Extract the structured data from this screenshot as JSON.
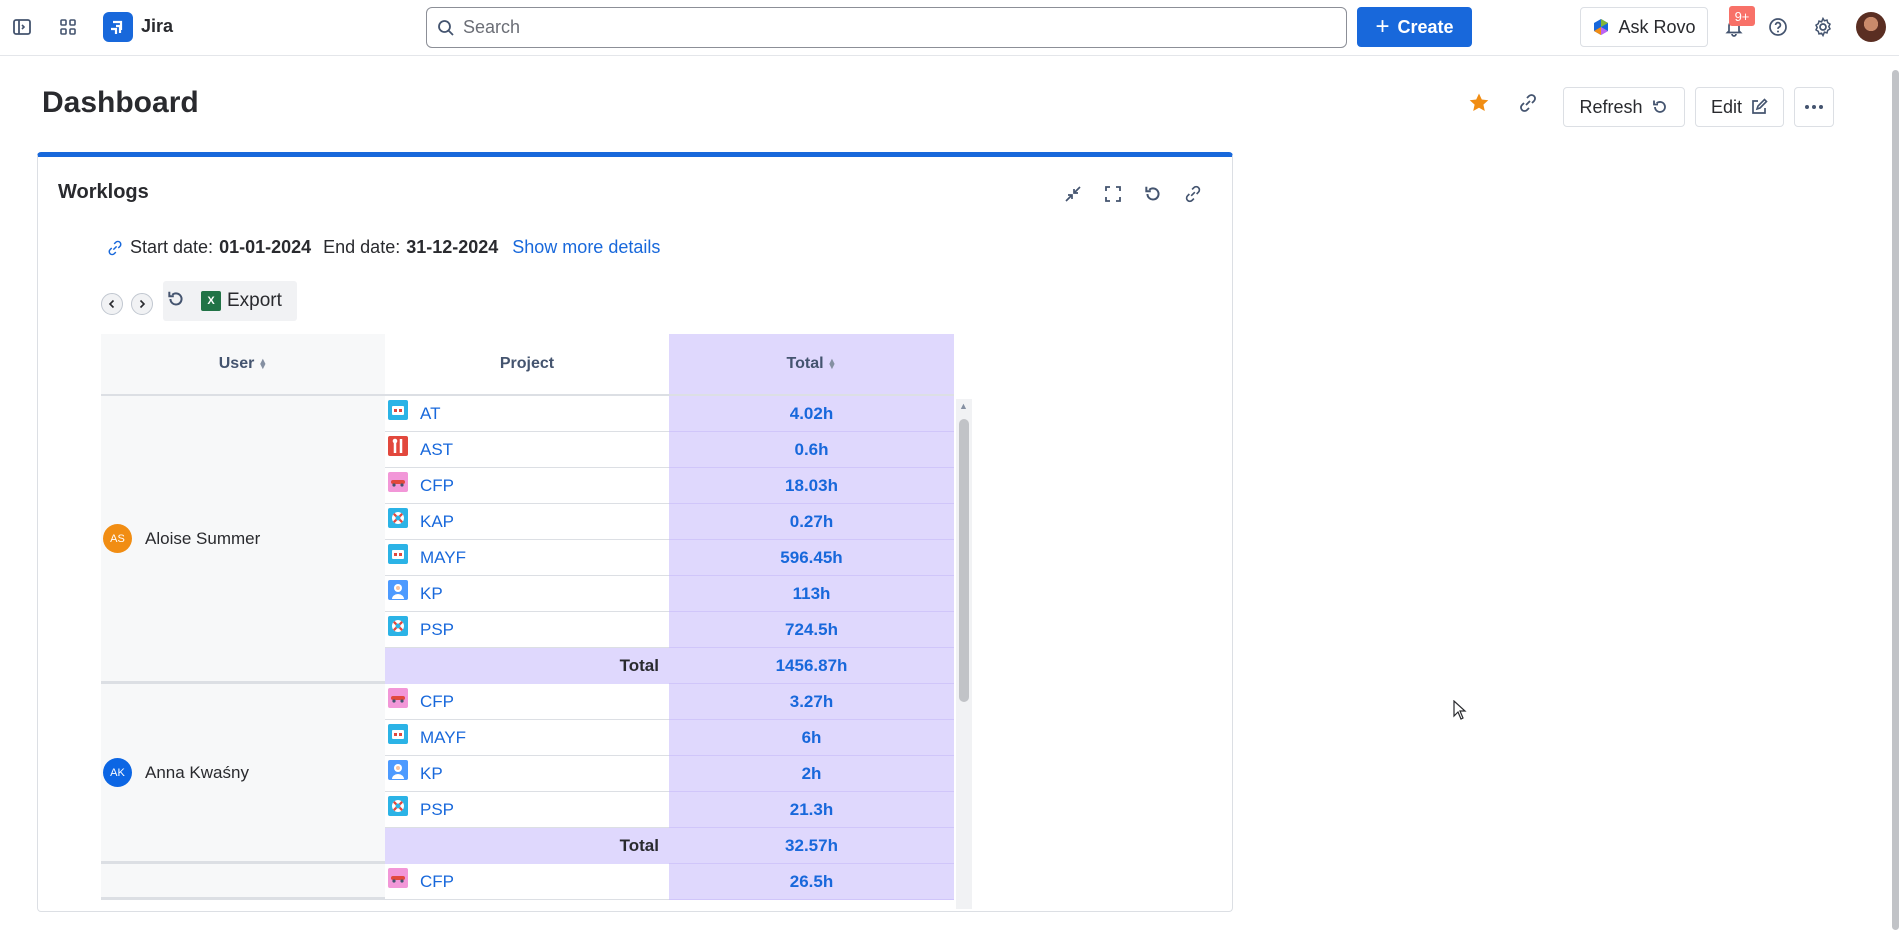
{
  "app": {
    "name": "Jira"
  },
  "search": {
    "placeholder": "Search"
  },
  "topbar": {
    "create_label": "Create",
    "rovo_label": "Ask Rovo",
    "notif_count": "9+"
  },
  "page": {
    "title": "Dashboard",
    "refresh_label": "Refresh",
    "edit_label": "Edit"
  },
  "gadget": {
    "title": "Worklogs",
    "start_label": "Start date:",
    "start_value": "01-01-2024",
    "end_label": "End date:",
    "end_value": "31-12-2024",
    "show_more": "Show more details",
    "export_label": "Export"
  },
  "table": {
    "headers": {
      "user": "User",
      "project": "Project",
      "total": "Total"
    },
    "total_label": "Total",
    "groups": [
      {
        "initials": "AS",
        "name": "Aloise Summer",
        "color": "#f18d13",
        "rows": [
          {
            "key": "AT",
            "icon": "robot-icon",
            "total": "4.02h"
          },
          {
            "key": "AST",
            "icon": "tools-icon",
            "total": "0.6h"
          },
          {
            "key": "CFP",
            "icon": "car-icon",
            "total": "18.03h"
          },
          {
            "key": "KAP",
            "icon": "lifebuoy-icon",
            "total": "0.27h"
          },
          {
            "key": "MAYF",
            "icon": "robot-icon",
            "total": "596.45h"
          },
          {
            "key": "KP",
            "icon": "person-icon",
            "total": "113h"
          },
          {
            "key": "PSP",
            "icon": "lifebuoy-icon",
            "total": "724.5h"
          }
        ],
        "group_total": "1456.87h"
      },
      {
        "initials": "AK",
        "name": "Anna Kwaśny",
        "color": "#0c66e4",
        "rows": [
          {
            "key": "CFP",
            "icon": "car-icon",
            "total": "3.27h"
          },
          {
            "key": "MAYF",
            "icon": "robot-icon",
            "total": "6h"
          },
          {
            "key": "KP",
            "icon": "person-icon",
            "total": "2h"
          },
          {
            "key": "PSP",
            "icon": "lifebuoy-icon",
            "total": "21.3h"
          }
        ],
        "group_total": "32.57h"
      },
      {
        "initials": "",
        "name": "",
        "color": "",
        "rows": [
          {
            "key": "CFP",
            "icon": "car-icon",
            "total": "26.5h"
          }
        ],
        "group_total": ""
      }
    ]
  }
}
